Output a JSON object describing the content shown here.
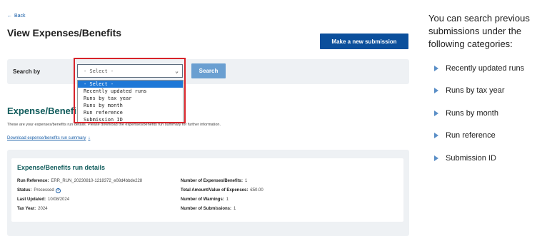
{
  "back": {
    "label": "Back"
  },
  "page_title": "View Expenses/Benefits",
  "new_submission_button": "Make a new submission",
  "search": {
    "label": "Search by",
    "selected": "- Select -",
    "button": "Search",
    "options": [
      "- Select -",
      "Recently updated runs",
      "Runs by tax year",
      "Runs by month",
      "Run reference",
      "Submission ID"
    ]
  },
  "section": {
    "heading": "Expense/Benefi",
    "description": "These are your expenses/benefits run details. Please download the expenses/benefits run summary for further information.",
    "download_link": "Download expense/benefits run summary",
    "download_icon": "↓"
  },
  "details": {
    "title": "Expense/Benefits run details",
    "left": [
      {
        "key": "Run Reference:",
        "value": "ERR_RUN_20230810-1218372_e08d4bbde228"
      },
      {
        "key": "Status:",
        "value": "Processed"
      },
      {
        "key": "Last Updated:",
        "value": "10/08/2024"
      },
      {
        "key": "Tax Year:",
        "value": "2024"
      }
    ],
    "right": [
      {
        "key": "Number of Expenses/Benefits:",
        "value": "1"
      },
      {
        "key": "Total Amount/Value of Expenses:",
        "value": "€50.00"
      },
      {
        "key": "Number of Warnings:",
        "value": "1"
      },
      {
        "key": "Number of Submissions:",
        "value": "1"
      }
    ]
  },
  "side_panel": {
    "intro": "You can search previous submissions under the following categories:",
    "items": [
      "Recently updated runs",
      "Runs by tax year",
      "Runs by month",
      "Run reference",
      "Submission ID"
    ]
  },
  "colors": {
    "primary_button": "#0b4f9c",
    "search_button": "#6a9fd1",
    "heading_teal": "#0f5b5b",
    "highlight_frame": "#d8232a",
    "option_selected": "#1e78d7"
  }
}
